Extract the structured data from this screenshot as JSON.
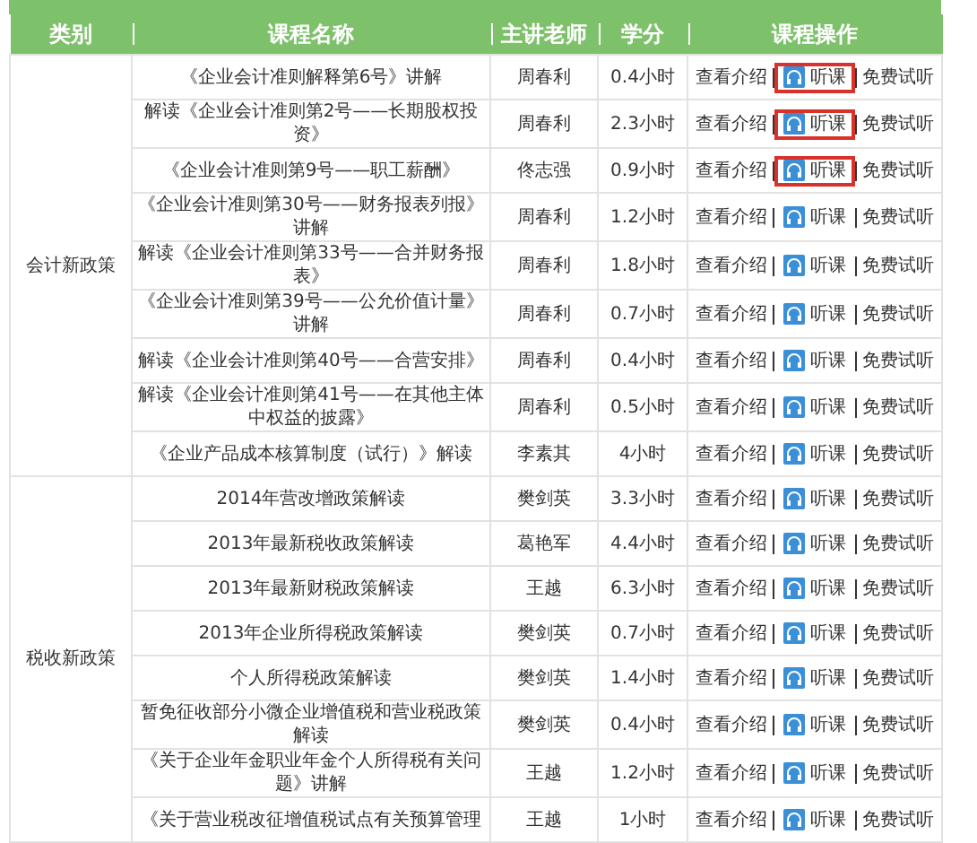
{
  "table": {
    "columns": [
      "类别",
      "课程名称",
      "主讲老师",
      "学分",
      "课程操作"
    ],
    "groups": [
      {
        "category": "会计新政策",
        "courses": [
          {
            "name": "《企业会计准则解释第6号》讲解",
            "teacher": "周春利",
            "credit": "0.4小时",
            "intro": "查看介绍",
            "listen": "听课",
            "trial": "免费试听",
            "highlighted": true
          },
          {
            "name": "解读《企业会计准则第2号——长期股权投资》",
            "teacher": "周春利",
            "credit": "2.3小时",
            "intro": "查看介绍",
            "listen": "听课",
            "trial": "免费试听",
            "highlighted": true
          },
          {
            "name": "《企业会计准则第9号——职工薪酬》",
            "teacher": "佟志强",
            "credit": "0.9小时",
            "intro": "查看介绍",
            "listen": "听课",
            "trial": "免费试听",
            "highlighted": true
          },
          {
            "name": "《企业会计准则第30号——财务报表列报》讲解",
            "teacher": "周春利",
            "credit": "1.2小时",
            "intro": "查看介绍",
            "listen": "听课",
            "trial": "免费试听",
            "highlighted": false
          },
          {
            "name": "解读《企业会计准则第33号——合并财务报表》",
            "teacher": "周春利",
            "credit": "1.8小时",
            "intro": "查看介绍",
            "listen": "听课",
            "trial": "免费试听",
            "highlighted": false
          },
          {
            "name": "《企业会计准则第39号——公允价值计量》讲解",
            "teacher": "周春利",
            "credit": "0.7小时",
            "intro": "查看介绍",
            "listen": "听课",
            "trial": "免费试听",
            "highlighted": false
          },
          {
            "name": "解读《企业会计准则第40号——合营安排》",
            "teacher": "周春利",
            "credit": "0.4小时",
            "intro": "查看介绍",
            "listen": "听课",
            "trial": "免费试听",
            "highlighted": false
          },
          {
            "name": "解读《企业会计准则第41号——在其他主体中权益的披露》",
            "teacher": "周春利",
            "credit": "0.5小时",
            "intro": "查看介绍",
            "listen": "听课",
            "trial": "免费试听",
            "highlighted": false
          },
          {
            "name": "《企业产品成本核算制度（试行）》解读",
            "teacher": "李素其",
            "credit": "4小时",
            "intro": "查看介绍",
            "listen": "听课",
            "trial": "免费试听",
            "highlighted": false
          }
        ]
      },
      {
        "category": "税收新政策",
        "courses": [
          {
            "name": "2014年营改增政策解读",
            "teacher": "樊剑英",
            "credit": "3.3小时",
            "intro": "查看介绍",
            "listen": "听课",
            "trial": "免费试听",
            "highlighted": false
          },
          {
            "name": "2013年最新税收政策解读",
            "teacher": "葛艳军",
            "credit": "4.4小时",
            "intro": "查看介绍",
            "listen": "听课",
            "trial": "免费试听",
            "highlighted": false
          },
          {
            "name": "2013年最新财税政策解读",
            "teacher": "王越",
            "credit": "6.3小时",
            "intro": "查看介绍",
            "listen": "听课",
            "trial": "免费试听",
            "highlighted": false
          },
          {
            "name": "2013年企业所得税政策解读",
            "teacher": "樊剑英",
            "credit": "0.7小时",
            "intro": "查看介绍",
            "listen": "听课",
            "trial": "免费试听",
            "highlighted": false
          },
          {
            "name": "个人所得税政策解读",
            "teacher": "樊剑英",
            "credit": "1.4小时",
            "intro": "查看介绍",
            "listen": "听课",
            "trial": "免费试听",
            "highlighted": false
          },
          {
            "name": "暂免征收部分小微企业增值税和营业税政策解读",
            "teacher": "樊剑英",
            "credit": "0.4小时",
            "intro": "查看介绍",
            "listen": "听课",
            "trial": "免费试听",
            "highlighted": false
          },
          {
            "name": "《关于企业年金职业年金个人所得税有关问题》讲解",
            "teacher": "王越",
            "credit": "1.2小时",
            "intro": "查看介绍",
            "listen": "听课",
            "trial": "免费试听",
            "highlighted": false
          },
          {
            "name": "《关于营业税改征增值税试点有关预算管理",
            "teacher": "王越",
            "credit": "1小时",
            "intro": "查看介绍",
            "listen": "听课",
            "trial": "免费试听",
            "highlighted": false
          }
        ]
      }
    ]
  }
}
